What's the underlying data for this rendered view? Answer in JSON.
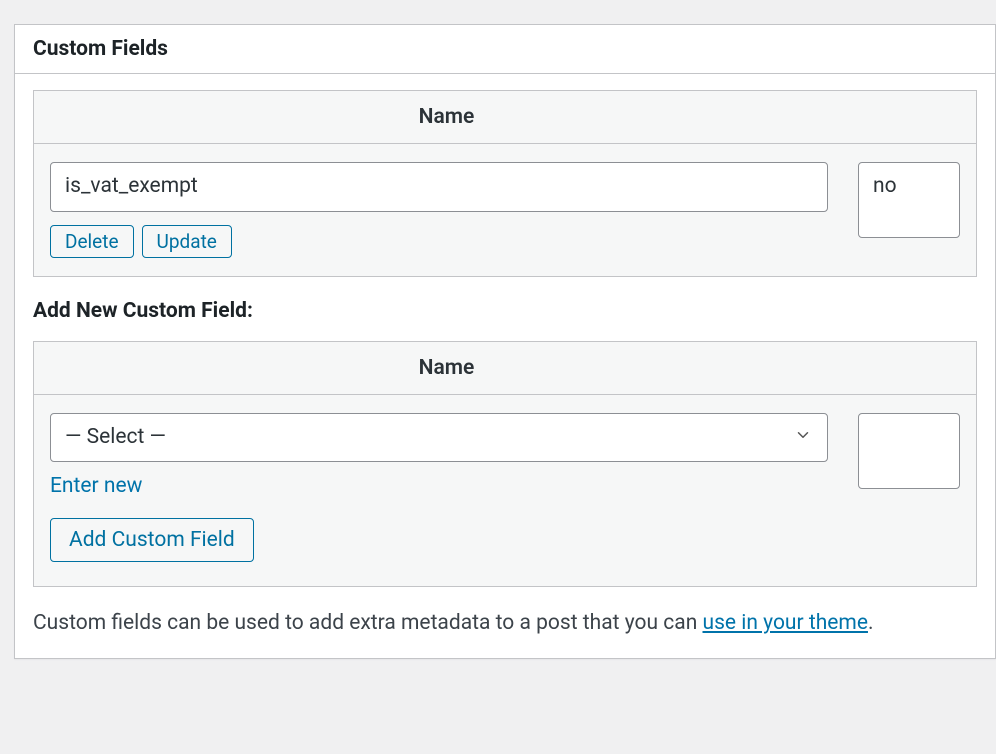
{
  "panel": {
    "title": "Custom Fields"
  },
  "existing": {
    "headers": {
      "name": "Name"
    },
    "rows": [
      {
        "key": "is_vat_exempt",
        "value": "no"
      }
    ],
    "buttons": {
      "delete": "Delete",
      "update": "Update"
    }
  },
  "add_new": {
    "heading": "Add New Custom Field:",
    "headers": {
      "name": "Name"
    },
    "select_placeholder": "— Select —",
    "enter_new": "Enter new",
    "add_button": "Add Custom Field"
  },
  "helper": {
    "prefix": "Custom fields can be used to add extra metadata to a post that you can ",
    "link": "use in your theme",
    "suffix": "."
  }
}
